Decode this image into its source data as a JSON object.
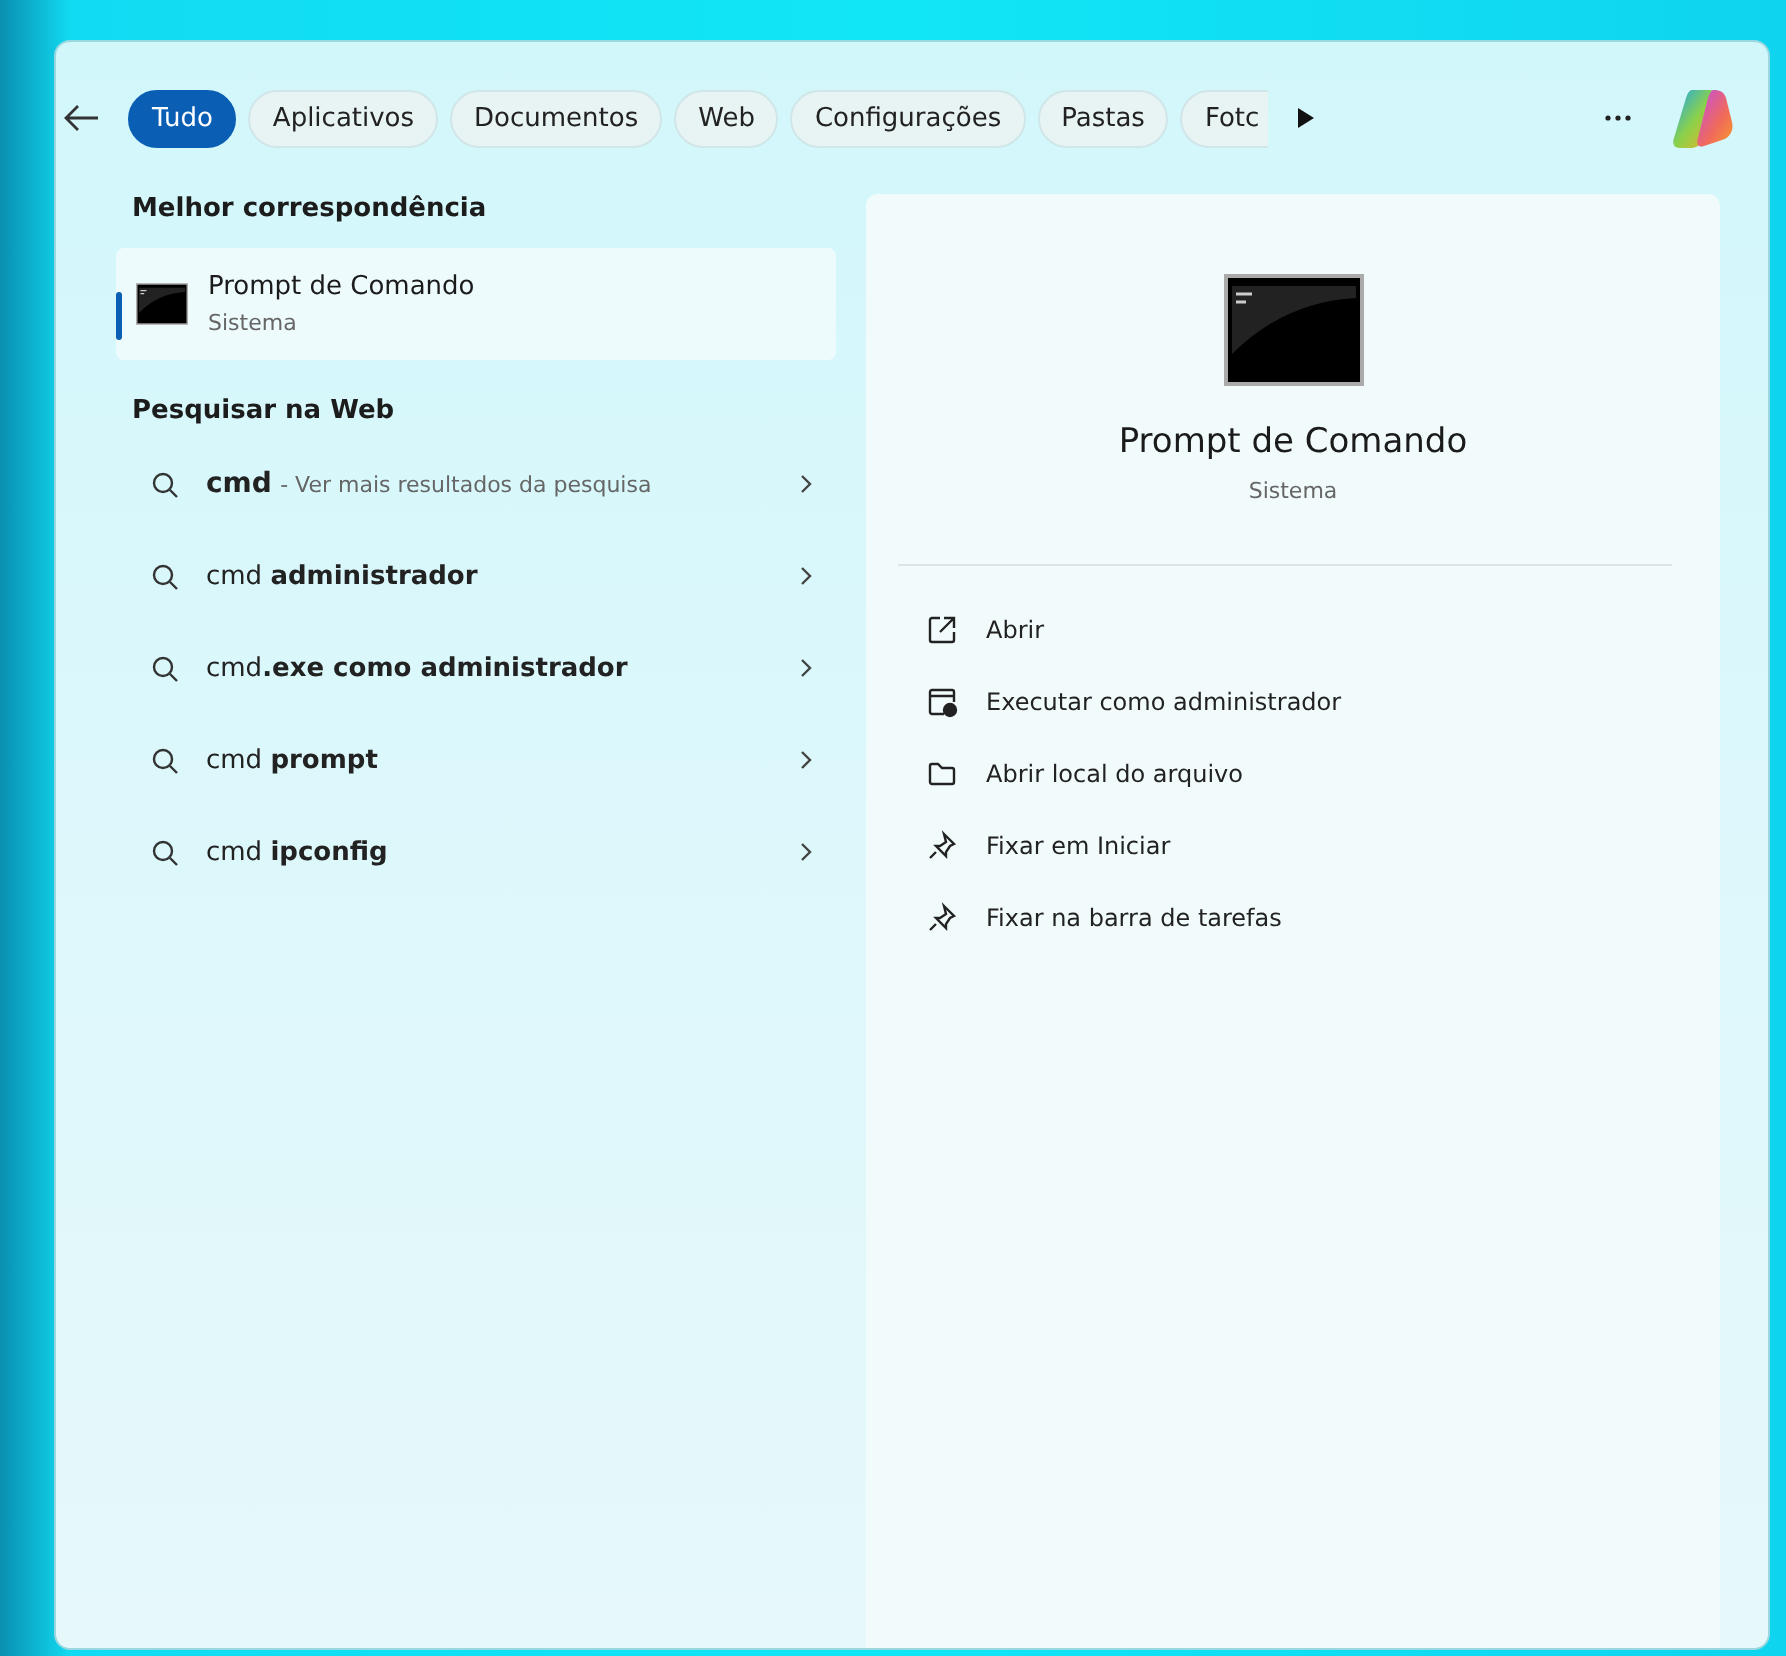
{
  "filters": [
    {
      "label": "Tudo",
      "selected": true
    },
    {
      "label": "Aplicativos",
      "selected": false
    },
    {
      "label": "Documentos",
      "selected": false
    },
    {
      "label": "Web",
      "selected": false
    },
    {
      "label": "Configurações",
      "selected": false
    },
    {
      "label": "Pastas",
      "selected": false
    },
    {
      "label": "Fotc",
      "selected": false
    }
  ],
  "best_match": {
    "heading": "Melhor correspondência",
    "item": {
      "title": "Prompt de Comando",
      "subtitle": "Sistema",
      "selected": true
    }
  },
  "web_search": {
    "heading": "Pesquisar na Web",
    "items": [
      {
        "kind": "more",
        "query": "cmd",
        "hint": "- Ver mais resultados da pesquisa"
      },
      {
        "kind": "suggestion",
        "text": "cmd **administrador**"
      },
      {
        "kind": "suggestion",
        "text": "cmd**.exe como administrador**"
      },
      {
        "kind": "suggestion",
        "text": "cmd **prompt**"
      },
      {
        "kind": "suggestion",
        "text": "cmd **ipconfig**"
      }
    ]
  },
  "details": {
    "title": "Prompt de Comando",
    "subtitle": "Sistema",
    "actions": [
      {
        "kind": "open",
        "label": "Abrir"
      },
      {
        "kind": "admin",
        "label": "Executar como administrador"
      },
      {
        "kind": "folder",
        "label": "Abrir local do arquivo"
      },
      {
        "kind": "pin",
        "label": "Fixar em Iniciar"
      },
      {
        "kind": "pin",
        "label": "Fixar na barra de tarefas"
      }
    ]
  }
}
